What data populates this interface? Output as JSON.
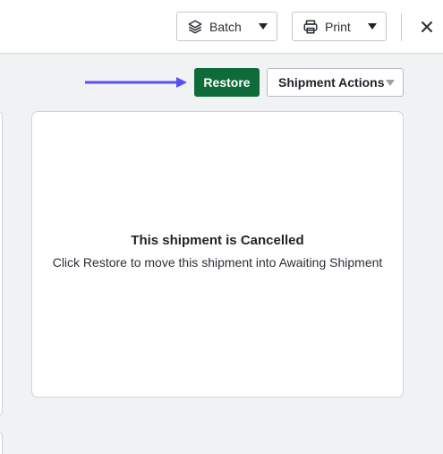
{
  "toolbar": {
    "batch_label": "Batch",
    "print_label": "Print",
    "batch_icon": "layers-icon",
    "print_icon": "printer-icon",
    "close_icon": "close-icon"
  },
  "actions": {
    "restore_label": "Restore",
    "shipment_actions_label": "Shipment Actions"
  },
  "notice": {
    "title": "This shipment is Cancelled",
    "message": "Click Restore to move this shipment into Awaiting Shipment"
  },
  "colors": {
    "restore_bg": "#0f6b3a",
    "arrow": "#5b4ef5"
  }
}
